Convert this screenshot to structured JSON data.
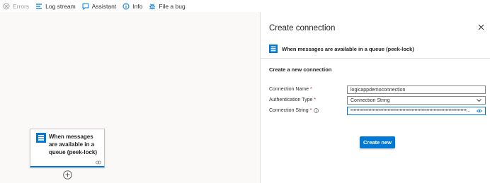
{
  "toolbar": {
    "items": [
      {
        "label": "Errors",
        "icon": "error-icon",
        "disabled": true
      },
      {
        "label": "Log stream",
        "icon": "log-stream-icon"
      },
      {
        "label": "Assistant",
        "icon": "chat-icon"
      },
      {
        "label": "Info",
        "icon": "info-icon"
      },
      {
        "label": "File a bug",
        "icon": "bug-icon"
      }
    ]
  },
  "canvas": {
    "trigger": {
      "title": "When messages are available in a queue (peek-lock)",
      "icon": "service-bus-icon"
    }
  },
  "panel": {
    "title": "Create connection",
    "operation": "When messages are available in a queue (peek-lock)",
    "section_heading": "Create a new connection",
    "fields": {
      "connection_name": {
        "label": "Connection Name",
        "required": "*",
        "value": "logicappdemoconnection"
      },
      "auth_type": {
        "label": "Authentication Type",
        "required": "*",
        "value": "Connection String"
      },
      "connection_string": {
        "label": "Connection String",
        "required": "*",
        "value": "••••••••••••••••••••••••••••••••••••••••••••••••••••••••••••••••••••••••••••••..."
      }
    },
    "create_button": "Create new"
  },
  "colors": {
    "accent": "#0078d4",
    "required": "#a4262c",
    "canvas_bg": "#faf9f8"
  }
}
